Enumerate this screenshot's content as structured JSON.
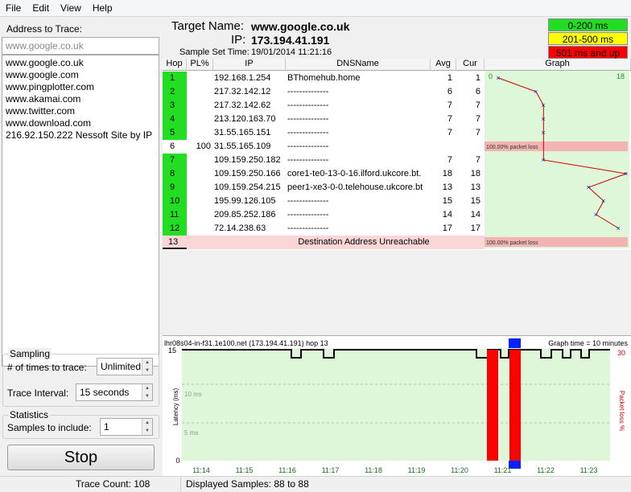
{
  "menu": [
    "File",
    "Edit",
    "View",
    "Help"
  ],
  "left": {
    "address_label": "Address to Trace:",
    "address_input": "www.google.co.uk",
    "addresses": [
      "www.google.co.uk",
      "www.google.com",
      "www.pingplotter.com",
      "www.akamai.com",
      "www.twitter.com",
      "www.download.com",
      "216.92.150.222 Nessoft Site by IP"
    ],
    "sampling_title": "Sampling",
    "times_label": "# of times to trace:",
    "times_value": "Unlimited",
    "interval_label": "Trace Interval:",
    "interval_value": "15 seconds",
    "statistics_title": "Statistics",
    "samples_label": "Samples to include:",
    "samples_value": "1",
    "stop_label": "Stop"
  },
  "header": {
    "target_name_label": "Target Name:",
    "target_name": "www.google.co.uk",
    "ip_label": "IP:",
    "ip": "173.194.41.191",
    "sample_set_label": "Sample Set Time:",
    "sample_set_time": "19/01/2014 11:21:16"
  },
  "legend": [
    {
      "label": "0-200 ms",
      "color": "#22dd22"
    },
    {
      "label": "201-500 ms",
      "color": "#ffff00"
    },
    {
      "label": "501 ms and up",
      "color": "#ff0000"
    }
  ],
  "columns": [
    "Hop",
    "PL%",
    "IP",
    "DNSName",
    "Avg",
    "Cur",
    "Graph"
  ],
  "hops": [
    {
      "hop": "1",
      "pl": "",
      "ip": "192.168.1.254",
      "dns": "BThomehub.home",
      "avg": "1",
      "cur": "1"
    },
    {
      "hop": "2",
      "pl": "",
      "ip": "217.32.142.12",
      "dns": "--------------",
      "avg": "6",
      "cur": "6"
    },
    {
      "hop": "3",
      "pl": "",
      "ip": "217.32.142.62",
      "dns": "--------------",
      "avg": "7",
      "cur": "7"
    },
    {
      "hop": "4",
      "pl": "",
      "ip": "213.120.163.70",
      "dns": "--------------",
      "avg": "7",
      "cur": "7"
    },
    {
      "hop": "5",
      "pl": "",
      "ip": "31.55.165.151",
      "dns": "--------------",
      "avg": "7",
      "cur": "7"
    },
    {
      "hop": "6",
      "pl": "100",
      "ip": "31.55.165.109",
      "dns": "--------------",
      "avg": "",
      "cur": ""
    },
    {
      "hop": "7",
      "pl": "",
      "ip": "109.159.250.182",
      "dns": "--------------",
      "avg": "7",
      "cur": "7"
    },
    {
      "hop": "8",
      "pl": "",
      "ip": "109.159.250.166",
      "dns": "core1-te0-13-0-16.ilford.ukcore.bt.",
      "avg": "18",
      "cur": "18"
    },
    {
      "hop": "9",
      "pl": "",
      "ip": "109.159.254.215",
      "dns": "peer1-xe3-0-0.telehouse.ukcore.bt",
      "avg": "13",
      "cur": "13"
    },
    {
      "hop": "10",
      "pl": "",
      "ip": "195.99.126.105",
      "dns": "--------------",
      "avg": "15",
      "cur": "15"
    },
    {
      "hop": "11",
      "pl": "",
      "ip": "209.85.252.186",
      "dns": "--------------",
      "avg": "14",
      "cur": "14"
    },
    {
      "hop": "12",
      "pl": "",
      "ip": "72.14.238.63",
      "dns": "--------------",
      "avg": "17",
      "cur": "17"
    }
  ],
  "final_row": {
    "hop": "13",
    "message": "Destination Address Unreachable"
  },
  "graph": {
    "scale_min": "0",
    "scale_max": "18",
    "loss_label": "100.00% packet loss"
  },
  "bottom_graph": {
    "title": "lhr08s04-in-f31.1e100.net (173.194.41.191) hop 13",
    "graph_time": "Graph time = 10 minutes",
    "ylabel": "Latency (ms)",
    "ylabel_right": "Packet loss %",
    "y_ticks": [
      "15",
      "0"
    ],
    "y_inner": [
      "10 ms",
      "5 ms"
    ],
    "right_tick": "30",
    "x_ticks": [
      "11:14",
      "11:15",
      "11:16",
      "11:17",
      "11:18",
      "11:19",
      "11:20",
      "11:21",
      "11:22",
      "11:23"
    ]
  },
  "status": {
    "trace_count": "Trace Count: 108",
    "displayed": "Displayed Samples: 88 to 88"
  }
}
